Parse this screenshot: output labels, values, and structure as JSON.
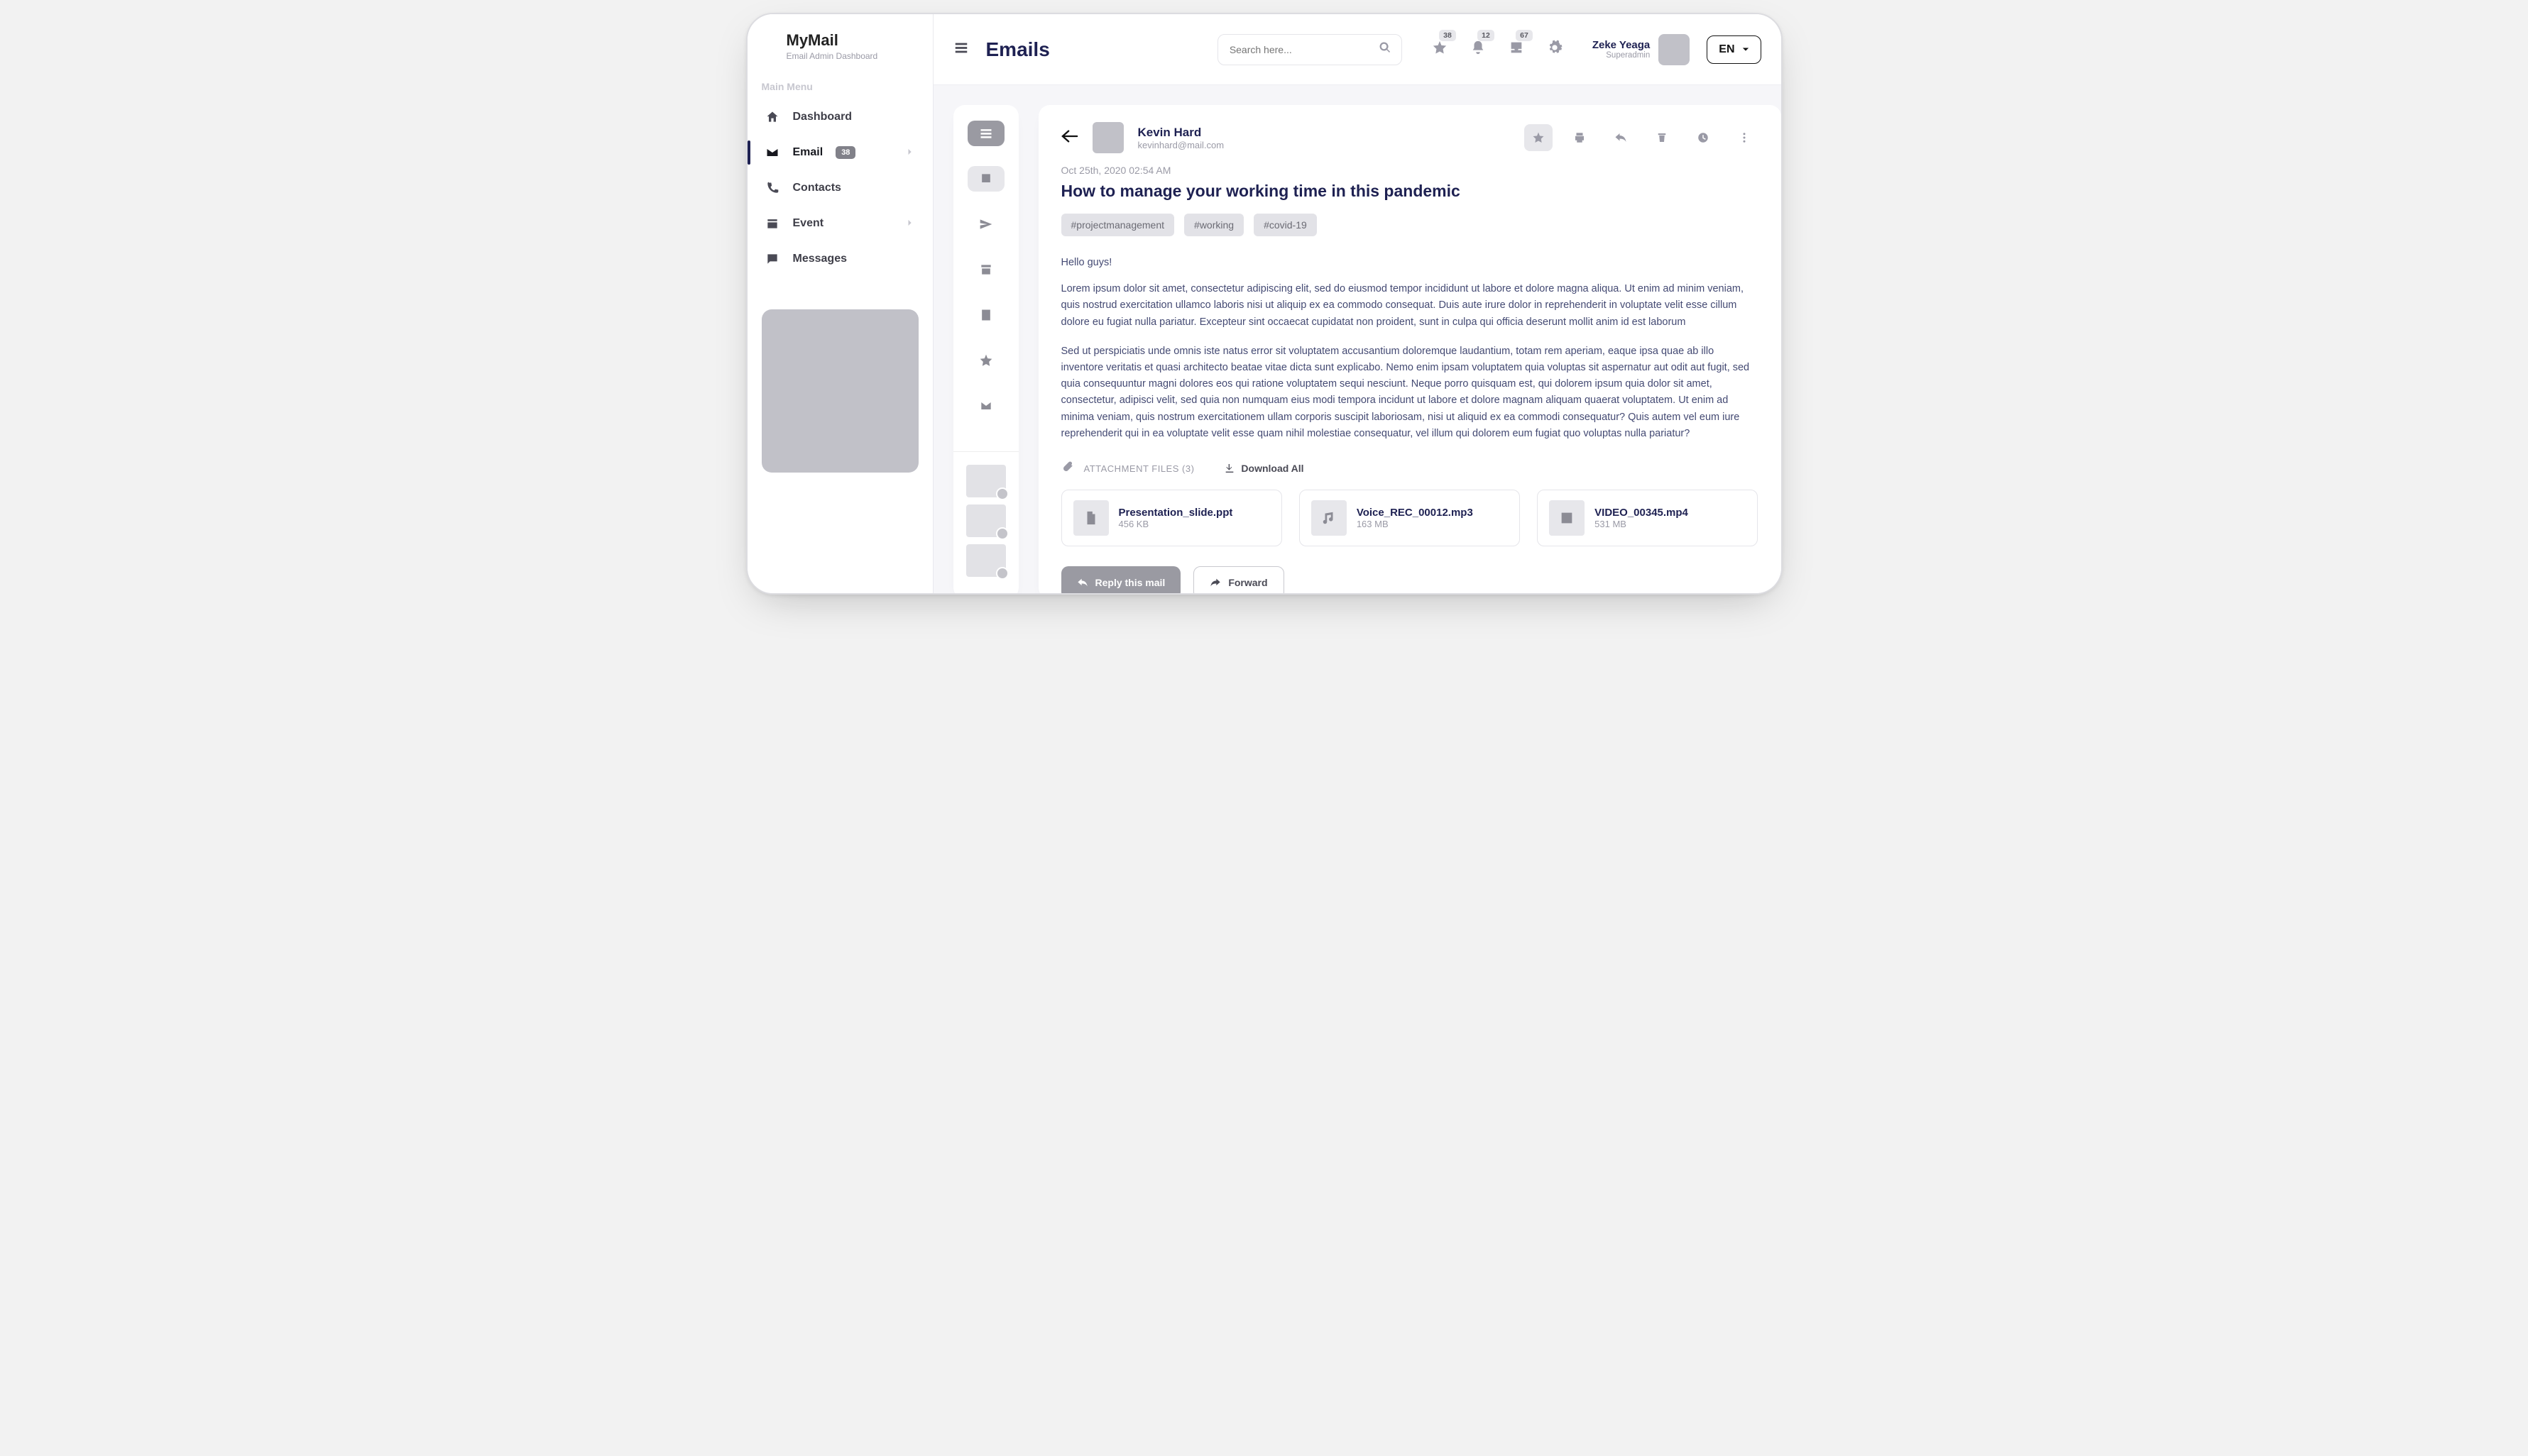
{
  "brand": {
    "name": "MyMail",
    "subtitle": "Email Admin Dashboard"
  },
  "sidebar": {
    "section": "Main Menu",
    "items": [
      {
        "label": "Dashboard",
        "id": "dashboard"
      },
      {
        "label": "Email",
        "id": "email",
        "badge": "38",
        "active": true,
        "chev": true
      },
      {
        "label": "Contacts",
        "id": "contacts"
      },
      {
        "label": "Event",
        "id": "event",
        "chev": true
      },
      {
        "label": "Messages",
        "id": "messages"
      }
    ]
  },
  "topbar": {
    "page_title": "Emails",
    "search_placeholder": "Search here...",
    "notif": {
      "star": "38",
      "bell": "12",
      "box": "67"
    },
    "user": {
      "name": "Zeke Yeaga",
      "role": "Superadmin"
    },
    "lang": "EN"
  },
  "mail": {
    "sender": {
      "name": "Kevin Hard",
      "email": "kevinhard@mail.com"
    },
    "timestamp": "Oct 25th, 2020   02:54 AM",
    "subject": "How to manage your working time in this pandemic",
    "tags": [
      "#projectmanagement",
      "#working",
      "#covid-19"
    ],
    "greeting": "Hello guys!",
    "para1": "Lorem ipsum dolor sit amet, consectetur adipiscing elit, sed do eiusmod tempor incididunt ut labore et dolore magna aliqua. Ut enim ad minim veniam, quis nostrud exercitation ullamco laboris nisi ut aliquip ex ea commodo consequat. Duis aute irure dolor in reprehenderit in voluptate velit esse cillum dolore eu fugiat nulla pariatur. Excepteur sint occaecat cupidatat non proident, sunt in culpa qui officia deserunt mollit anim id est laborum",
    "para2": "Sed ut perspiciatis unde omnis iste natus error sit voluptatem accusantium doloremque laudantium, totam rem aperiam, eaque ipsa quae ab illo inventore veritatis et quasi architecto beatae vitae dicta sunt explicabo. Nemo enim ipsam voluptatem quia voluptas sit aspernatur aut odit aut fugit, sed quia consequuntur magni dolores eos qui ratione voluptatem sequi nesciunt. Neque porro quisquam est, qui dolorem ipsum quia dolor sit amet, consectetur, adipisci velit, sed quia non numquam eius modi tempora incidunt ut labore et dolore magnam aliquam quaerat voluptatem. Ut enim ad minima veniam, quis nostrum exercitationem ullam corporis suscipit laboriosam, nisi ut aliquid ex ea commodi consequatur? Quis autem vel eum iure reprehenderit qui in ea voluptate velit esse quam nihil molestiae consequatur, vel illum qui dolorem eum fugiat quo voluptas nulla pariatur?",
    "attachments": {
      "heading": "ATTACHMENT FILES (3)",
      "download_all": "Download All",
      "items": [
        {
          "name": "Presentation_slide.ppt",
          "size": "456 KB",
          "icon": "file"
        },
        {
          "name": "Voice_REC_00012.mp3",
          "size": "163 MB",
          "icon": "music"
        },
        {
          "name": "VIDEO_00345.mp4",
          "size": "531 MB",
          "icon": "video"
        }
      ]
    },
    "actions": {
      "reply": "Reply this mail",
      "forward": "Forward"
    }
  }
}
